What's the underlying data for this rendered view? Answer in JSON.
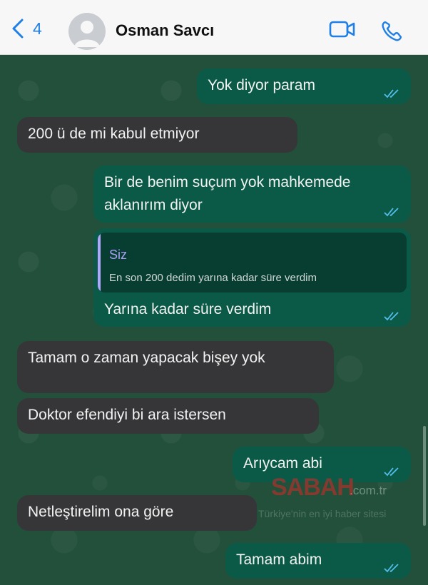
{
  "header": {
    "back_count": "4",
    "contact_name": "Osman Savcı",
    "accent": "#1f7fe5"
  },
  "messages": [
    {
      "dir": "out",
      "text": "Yok diyor param",
      "status": "read"
    },
    {
      "dir": "in",
      "text": "200 ü de mi kabul etmiyor"
    },
    {
      "dir": "out",
      "lines": [
        "Bir de benim suçum yok mahkemede",
        "aklanırım diyor"
      ],
      "status": "read"
    },
    {
      "dir": "out",
      "reply_to": {
        "author": "Siz",
        "text": "En son 200 dedim yarına kadar süre verdim"
      },
      "text": "Yarına kadar süre verdim",
      "status": "read"
    },
    {
      "dir": "in",
      "text": "Tamam o zaman yapacak bişey yok"
    },
    {
      "dir": "in",
      "text": "Doktor efendiyi bi ara istersen"
    },
    {
      "dir": "out",
      "text": "Arıycam abi",
      "status": "read"
    },
    {
      "dir": "in",
      "text": "Netleştirelim ona göre"
    },
    {
      "dir": "out",
      "text": "Tamam abim",
      "status": "read"
    }
  ],
  "watermark": {
    "brand": "SABAH",
    "domain": ".com.tr",
    "tagline": "Türkiye'nin en iyi haber sitesi"
  },
  "colors": {
    "chat_bg": "#22503a",
    "outgoing": "#0b5a47",
    "incoming": "#363638",
    "read_ticks": "#53bdeb"
  }
}
